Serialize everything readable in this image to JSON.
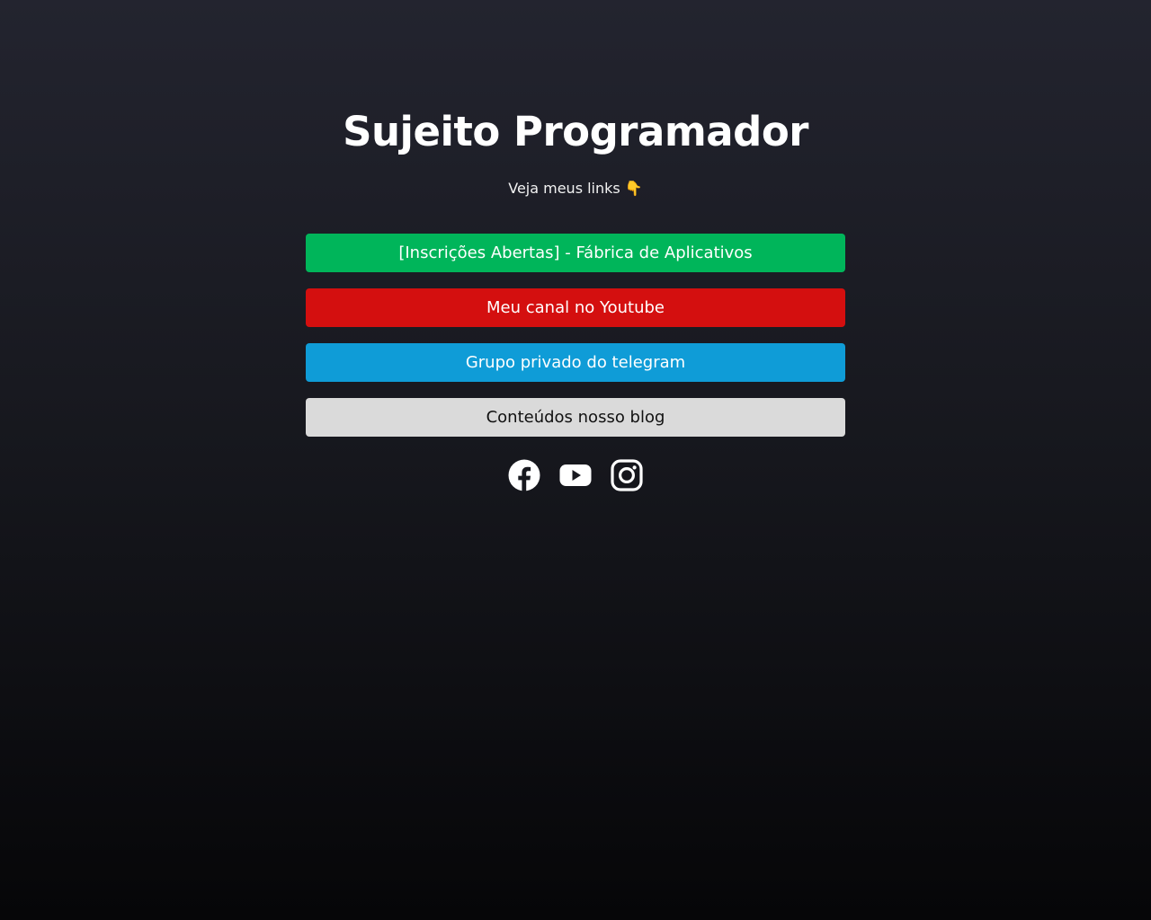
{
  "header": {
    "title": "Sujeito Programador",
    "subtitle": "Veja meus links 👇"
  },
  "links": [
    {
      "label": "[Inscrições Abertas] - Fábrica de Aplicativos",
      "color": "#00b55a"
    },
    {
      "label": "Meu canal no Youtube",
      "color": "#d40f0f"
    },
    {
      "label": "Grupo privado do telegram",
      "color": "#0f9cd7"
    },
    {
      "label": "Conteúdos nosso blog",
      "color": "#dadada"
    }
  ],
  "socials": [
    {
      "icon": "facebook-icon"
    },
    {
      "icon": "youtube-icon"
    },
    {
      "icon": "instagram-icon"
    }
  ],
  "colors": {
    "background_top": "#23242f",
    "background_bottom": "#060608",
    "text": "#ffffff"
  }
}
